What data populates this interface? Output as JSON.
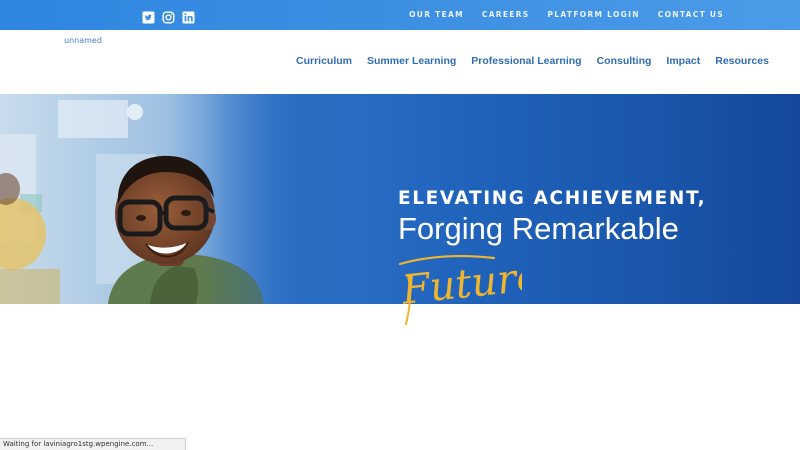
{
  "colors": {
    "topbar": "#3d8fe3",
    "nav_link": "#2f6eb3",
    "hero_blue": "#1f61b8",
    "script_gold": "#f0b52e"
  },
  "social": {
    "items": [
      {
        "name": "twitter-icon"
      },
      {
        "name": "instagram-icon"
      },
      {
        "name": "linkedin-icon"
      }
    ]
  },
  "utility_nav": {
    "items": [
      "OUR TEAM",
      "CAREERS",
      "PLATFORM LOGIN",
      "CONTACT US"
    ]
  },
  "header": {
    "logo_alt": "unnamed"
  },
  "main_nav": {
    "items": [
      "Curriculum",
      "Summer Learning",
      "Professional Learning",
      "Consulting",
      "Impact",
      "Resources"
    ]
  },
  "hero": {
    "line1": "ELEVATING ACHIEVEMENT,",
    "line2": "Forging Remarkable",
    "script_word": "Futures"
  },
  "status": {
    "text": "Waiting for laviniagro1stg.wpengine.com..."
  }
}
